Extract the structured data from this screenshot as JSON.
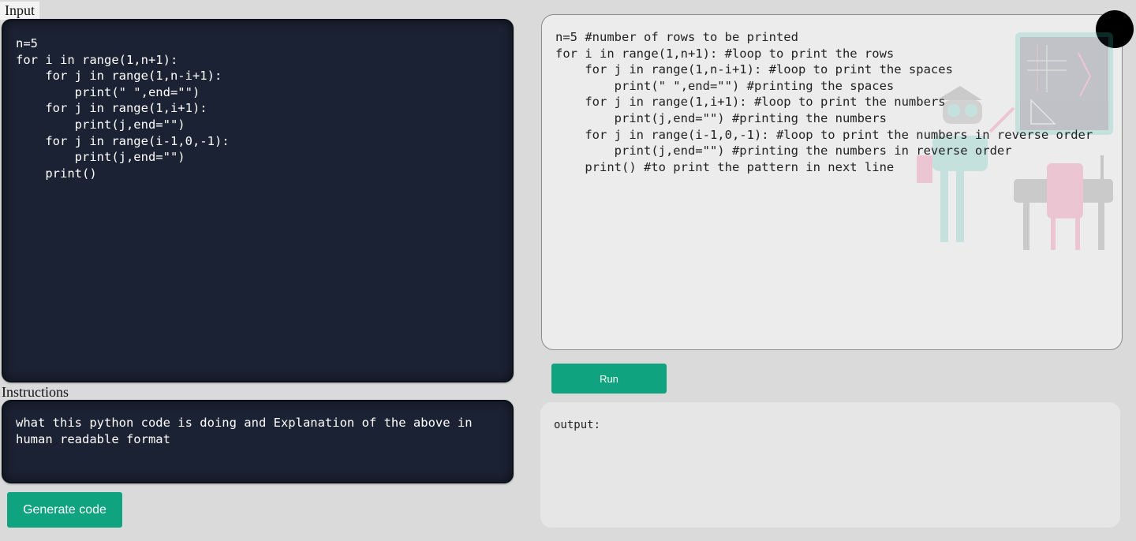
{
  "labels": {
    "input": "Input",
    "instructions": "Instructions"
  },
  "input_code": "n=5\nfor i in range(1,n+1):\n    for j in range(1,n-i+1):\n        print(\" \",end=\"\")\n    for j in range(1,i+1):\n        print(j,end=\"\")\n    for j in range(i-1,0,-1):\n        print(j,end=\"\")\n    print()",
  "instructions_text": "what this python code is doing and Explanation of the above in human readable format",
  "buttons": {
    "generate": "Generate code",
    "run": "Run"
  },
  "generated_code": "n=5 #number of rows to be printed\nfor i in range(1,n+1): #loop to print the rows\n    for j in range(1,n-i+1): #loop to print the spaces\n        print(\" \",end=\"\") #printing the spaces\n    for j in range(1,i+1): #loop to print the numbers\n        print(j,end=\"\") #printing the numbers\n    for j in range(i-1,0,-1): #loop to print the numbers in reverse order\n        print(j,end=\"\") #printing the numbers in reverse order\n    print() #to print the pattern in next line",
  "output_label": "output:",
  "colors": {
    "accent": "#10a37f",
    "editor_bg": "#1b2233",
    "page_bg": "#dadada"
  },
  "icons": {
    "illustration": "robot-teacher-illustration",
    "avatar": "user-avatar"
  }
}
